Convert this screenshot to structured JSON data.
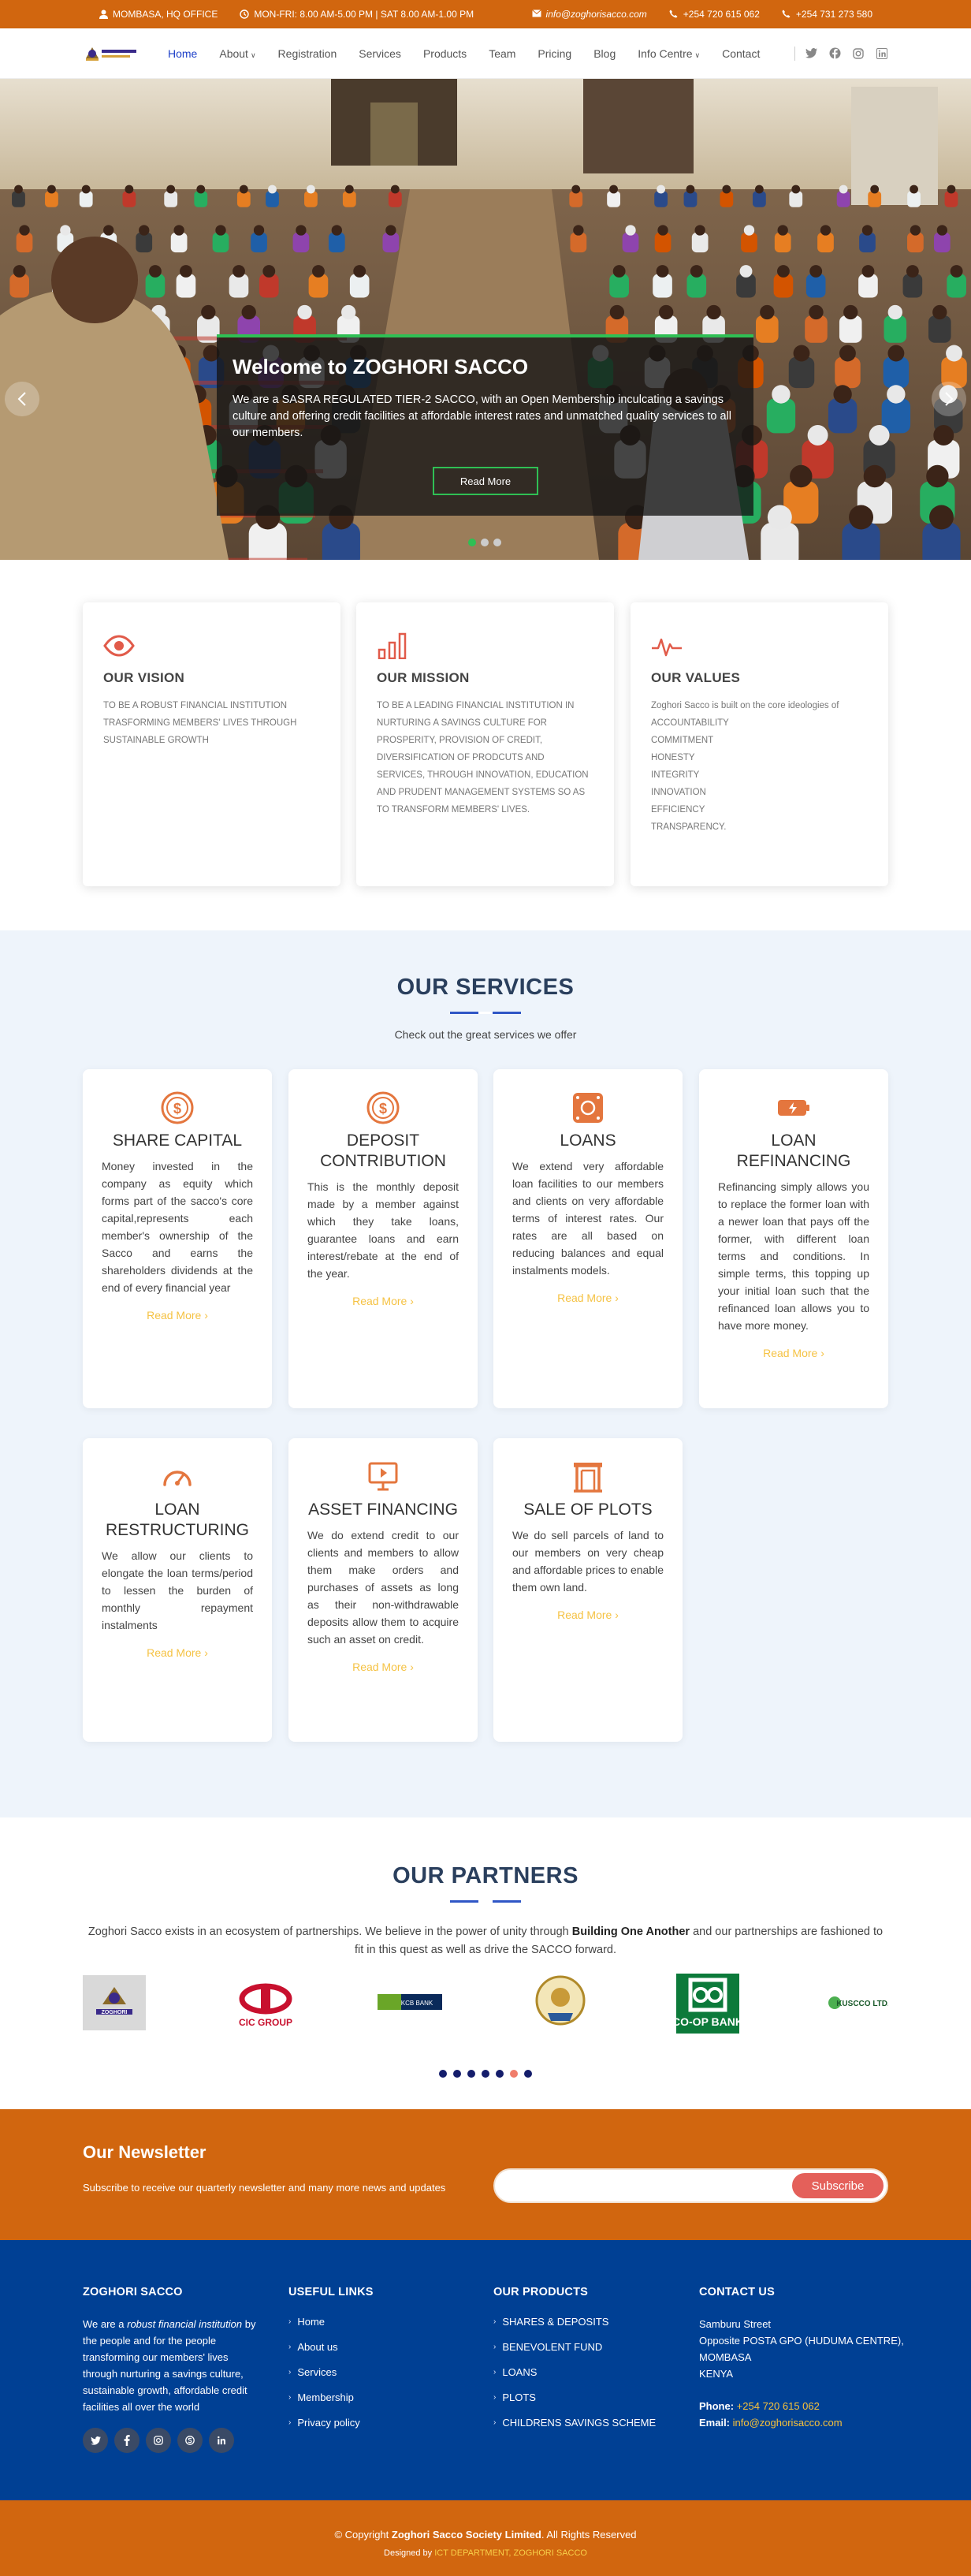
{
  "topbar": {
    "location": "MOMBASA, HQ OFFICE",
    "hours": "MON-FRI: 8.00 AM-5.00 PM | SAT 8.00 AM-1.00 PM",
    "email": "info@zoghorisacco.com",
    "phone1": "+254 720 615 062",
    "phone2": "+254 731 273 580",
    "icons": [
      "user-pin-icon",
      "clock-icon",
      "mail-icon",
      "phone-icon",
      "phone-icon"
    ]
  },
  "header": {
    "logo_text": "ZOGHORI SACCO",
    "nav": [
      {
        "label": "Home",
        "active": true
      },
      {
        "label": "About",
        "dropdown": true
      },
      {
        "label": "Registration"
      },
      {
        "label": "Services"
      },
      {
        "label": "Products"
      },
      {
        "label": "Team"
      },
      {
        "label": "Pricing"
      },
      {
        "label": "Blog"
      },
      {
        "label": "Info Centre",
        "dropdown": true
      },
      {
        "label": "Contact"
      }
    ],
    "social": [
      "twitter-icon",
      "facebook-icon",
      "instagram-icon",
      "linkedin-icon"
    ]
  },
  "hero": {
    "title": "Welcome to ZOGHORI SACCO",
    "text": "We are a SASRA REGULATED TIER-2 SACCO, with an Open Membership inculcating a savings culture and offering credit facilities at affordable interest rates and unmatched quality services to all our members.",
    "button": "Read More",
    "slide_count": 3,
    "active_slide": 1,
    "accent": "#2fbf54"
  },
  "vmv": [
    {
      "icon": "eye-icon",
      "title": "OUR VISION",
      "text": "TO BE A ROBUST FINANCIAL INSTITUTION TRASFORMING MEMBERS' LIVES THROUGH SUSTAINABLE GROWTH"
    },
    {
      "icon": "bar-chart-icon",
      "title": "OUR MISSION",
      "text": "TO BE A LEADING FINANCIAL INSTITUTION IN NURTURING A SAVINGS CULTURE FOR PROSPERITY, PROVISION OF CREDIT, DIVERSIFICATION OF PRODCUTS AND SERVICES, THROUGH INNOVATION, EDUCATION AND PRUDENT MANAGEMENT SYSTEMS SO AS TO TRANSFORM MEMBERS' LIVES."
    },
    {
      "icon": "pulse-icon",
      "title": "OUR VALUES",
      "text": "Zoghori Sacco is built on the core ideologies of\nACCOUNTABILITY\nCOMMITMENT\nHONESTY\nINTEGRITY\nINNOVATION\nEFFICIENCY\nTRANSPARENCY."
    }
  ],
  "services": {
    "title": "OUR SERVICES",
    "subtitle": "Check out the great services we offer",
    "read_more": "Read More",
    "items": [
      {
        "icon": "dollar-circle-icon",
        "title": "SHARE CAPITAL",
        "text": "Money invested in the company as equity which forms part of the sacco's core capital,represents each member's ownership of the Sacco and earns the shareholders dividends at the end of every financial year"
      },
      {
        "icon": "dollar-circle-icon",
        "title": "DEPOSIT CONTRIBUTION",
        "text": "This is the monthly deposit made by a member against which they take loans, guarantee loans and earn interest/rebate at the end of the year."
      },
      {
        "icon": "money-bill-icon",
        "title": "LOANS",
        "text": "We extend very affordable loan facilities to our members and clients on very affordable terms of interest rates. Our rates are all based on reducing balances and equal instalments models."
      },
      {
        "icon": "battery-charging-icon",
        "title": "LOAN REFINANCING",
        "text": "Refinancing simply allows you to replace the former loan with a newer loan that pays off the former, with different loan terms and conditions. In simple terms, this topping up your initial loan such that the refinanced loan allows you to have more money."
      },
      {
        "icon": "speedometer-icon",
        "title": "LOAN RESTRUCTURING",
        "text": "We allow our clients to elongate the loan terms/period to lessen the burden of monthly repayment instalments"
      },
      {
        "icon": "presentation-icon",
        "title": "ASSET FINANCING",
        "text": "We do extend credit to our clients and members to allow them make orders and purchases of assets as long as their non-withdrawable deposits allow them to acquire such an asset on credit."
      },
      {
        "icon": "building-icon",
        "title": "SALE OF PLOTS",
        "text": "We do sell parcels of land to our members on very cheap and affordable prices to enable them own land."
      }
    ],
    "accent": "#e4763e"
  },
  "partners": {
    "title": "OUR PARTNERS",
    "intro_before": "Zoghori Sacco exists in an ecosystem of partnerships. We believe in the power of unity through ",
    "intro_bold": "Building One Another",
    "intro_after": " and our partnerships are fashioned to fit in this quest as well as drive the SACCO forward.",
    "logos": [
      {
        "name": "ZOGHORI"
      },
      {
        "name": "CIC GROUP"
      },
      {
        "name": "KCB BANK"
      },
      {
        "name": "crest"
      },
      {
        "name": "CO-OP BANK"
      },
      {
        "name": "KUSCCO LTD."
      }
    ],
    "dot_count": 7,
    "active_dot": 6
  },
  "newsletter": {
    "title": "Our Newsletter",
    "text": "Subscribe to receive our quarterly newsletter and many more news and updates",
    "placeholder": "",
    "button": "Subscribe"
  },
  "footer": {
    "about_title": "ZOGHORI SACCO",
    "about_before": "We are a ",
    "about_em": "robust financial institution",
    "about_after": " by the people and for the people transforming our members' lives through nurturing a savings culture, sustainable growth, affordable credit facilities all over the world",
    "social": [
      "twitter-icon",
      "facebook-icon",
      "instagram-icon",
      "skype-icon",
      "linkedin-icon"
    ],
    "links_title": "USEFUL LINKS",
    "links": [
      "Home",
      "About us",
      "Services",
      "Membership",
      "Privacy policy"
    ],
    "products_title": "OUR PRODUCTS",
    "products": [
      "SHARES & DEPOSITS",
      "BENEVOLENT FUND",
      "LOANS",
      "PLOTS",
      "CHILDRENS SAVINGS SCHEME"
    ],
    "contact_title": "CONTACT US",
    "address": [
      "Samburu Street",
      "Opposite POSTA GPO (HUDUMA CENTRE), MOMBASA",
      "KENYA"
    ],
    "phone_label": "Phone:",
    "phone": "+254 720 615 062",
    "email_label": "Email:",
    "email": "info@zoghorisacco.com"
  },
  "bottom": {
    "copy_before": "© Copyright ",
    "copy_bold": "Zoghori Sacco Society Limited",
    "copy_after": ". All Rights Reserved",
    "designed_by": "Designed by ",
    "designer": "ICT DEPARTMENT, ZOGHORI SACCO"
  },
  "colors": {
    "orange": "#d1660f",
    "navy": "#004094",
    "nav_active": "#1e40c8",
    "light_bg": "#eef4fb"
  }
}
